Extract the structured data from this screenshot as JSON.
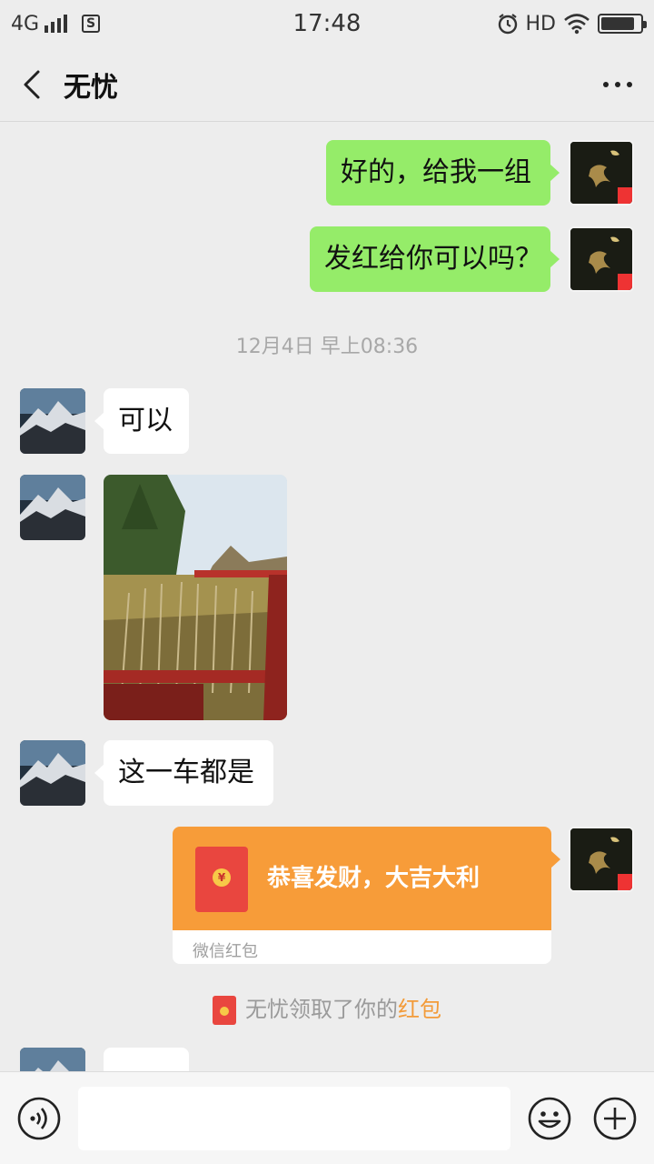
{
  "status_bar": {
    "network": "4G",
    "sim_icon": "S",
    "time": "17:48",
    "hd": "HD",
    "battery_level": 0.85
  },
  "header": {
    "title": "无忧"
  },
  "messages": {
    "m1": "好的，给我一组",
    "m2": "发红给你可以吗？",
    "timestamp": "12月4日 早上08:36",
    "m3": "可以",
    "m4": "这一车都是",
    "red_packet": {
      "greeting": "恭喜发财，大吉大利",
      "label": "微信红包",
      "coin_symbol": "¥"
    },
    "notice_prefix": "无忧领取了你的",
    "notice_link": "红包"
  },
  "input_bar": {
    "placeholder": ""
  },
  "colors": {
    "my_bubble": "#95ec69",
    "red_packet": "#f79c39",
    "link": "#f39b39"
  }
}
